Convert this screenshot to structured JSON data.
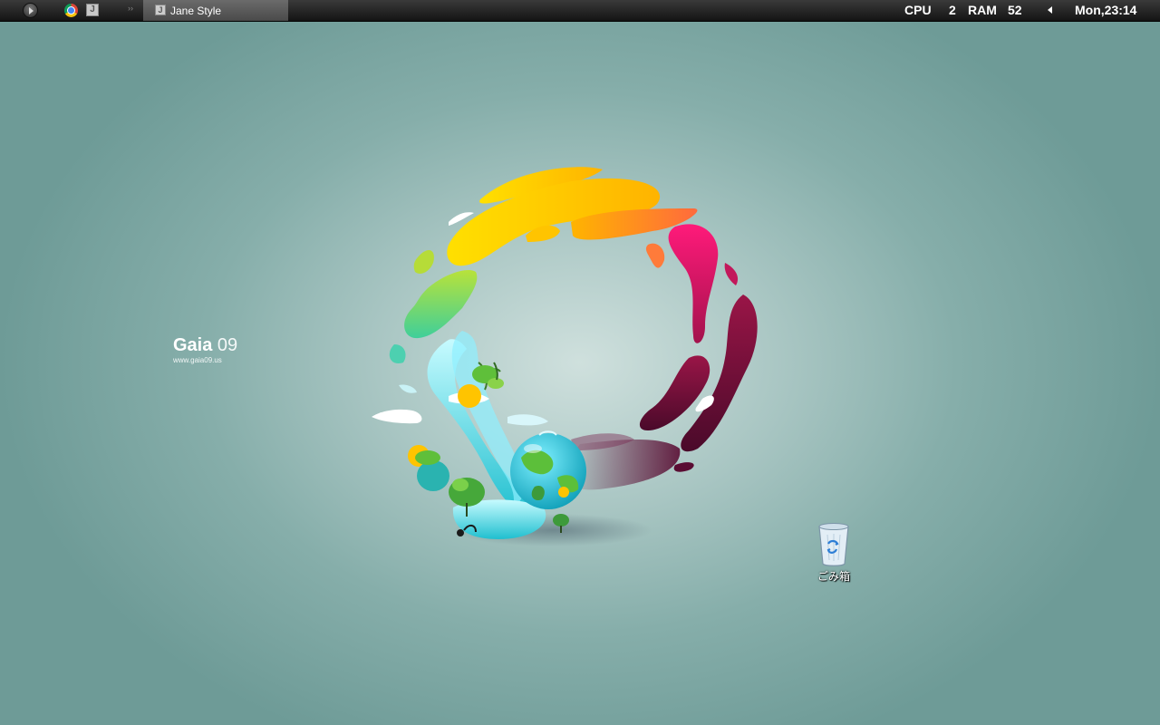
{
  "taskbar": {
    "start_icon": "play-icon",
    "quicklaunch": [
      {
        "icon": "chrome-icon"
      },
      {
        "icon": "jane-style-icon",
        "glyph": "J"
      }
    ],
    "chevron": "››",
    "tasks": [
      {
        "icon": "jane-style-icon",
        "glyph": "J",
        "label": "Jane Style"
      }
    ],
    "tray": {
      "cpu_label": "CPU",
      "cpu_value": "2",
      "ram_label": "RAM",
      "ram_value": "52",
      "clock": "Mon,23:14"
    }
  },
  "wallpaper": {
    "brand_bold": "Gaia",
    "brand_num": "09",
    "url": "www.gaia09.us"
  },
  "desktop_icons": [
    {
      "icon": "recycle-bin-icon",
      "label": "ごみ箱"
    }
  ],
  "colors": {
    "background": "#8fb3b0",
    "taskbar": "#1e1e1e",
    "active_task": "#5a5a5a"
  }
}
